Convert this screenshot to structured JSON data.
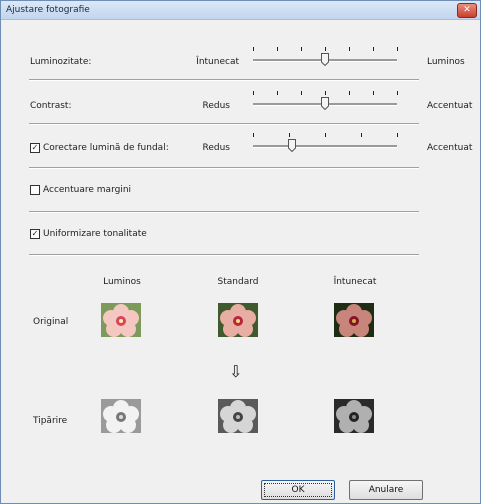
{
  "window": {
    "title": "Ajustare fotografie",
    "close_symbol": "✕"
  },
  "sliders": [
    {
      "label": "Luminozitate:",
      "left": "Întunecat",
      "right": "Luminos",
      "value_percent": 50,
      "ticks": 7
    },
    {
      "label": "Contrast:",
      "left": "Redus",
      "right": "Accentuat",
      "value_percent": 50,
      "ticks": 7
    },
    {
      "label": "Corectare lumină de fundal:",
      "left": "Redus",
      "right": "Accentuat",
      "value_percent": 27,
      "ticks": 5,
      "checkbox": true
    }
  ],
  "checkboxes": [
    {
      "label": "Accentuare margini",
      "checked": false
    },
    {
      "label": "Uniformizare tonalitate",
      "checked": true
    }
  ],
  "preview": {
    "columns": [
      "Luminos",
      "Standard",
      "Întunecat"
    ],
    "rows": [
      "Original",
      "Tipărire"
    ],
    "arrow_icon": "⇩"
  },
  "buttons": {
    "ok": "OK",
    "cancel": "Anulare"
  },
  "check_mark": "✓"
}
